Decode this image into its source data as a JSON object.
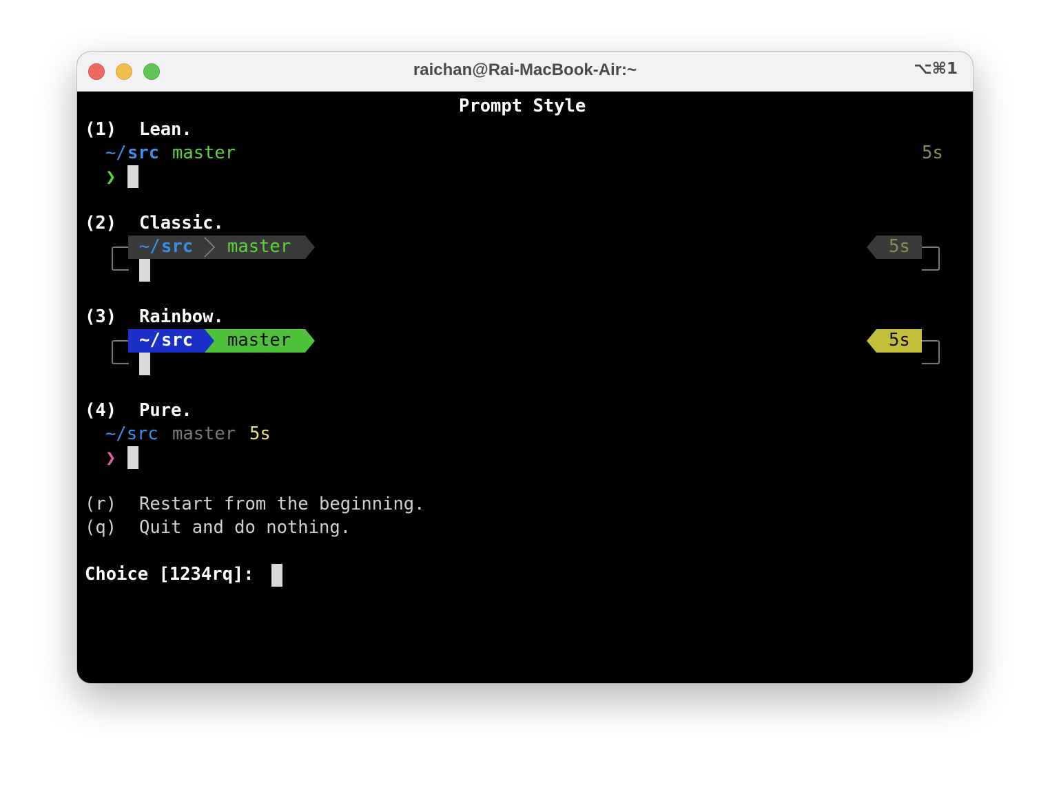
{
  "window": {
    "title": "raichan@Rai-MacBook-Air:~",
    "shortcut": "⌥⌘1"
  },
  "terminal": {
    "heading": "Prompt Style",
    "options": [
      {
        "key": "(1)",
        "label": "Lean.",
        "dir_prefix": "~/",
        "dir": "src",
        "branch": "master",
        "duration": "5s",
        "prompt_char": "❯"
      },
      {
        "key": "(2)",
        "label": "Classic.",
        "dir_prefix": "~/",
        "dir": "src",
        "branch": "master",
        "duration": "5s"
      },
      {
        "key": "(3)",
        "label": "Rainbow.",
        "dir_prefix": "~/",
        "dir": "src",
        "branch": "master",
        "duration": "5s"
      },
      {
        "key": "(4)",
        "label": "Pure.",
        "dir": "~/src",
        "branch": "master",
        "duration": "5s",
        "prompt_char": "❯"
      }
    ],
    "extra": [
      {
        "key": "(r)",
        "label": "Restart from the beginning."
      },
      {
        "key": "(q)",
        "label": "Quit and do nothing."
      }
    ],
    "choice_prompt": "Choice [1234rq]:"
  },
  "colors": {
    "lean_dir": "#3b8eea",
    "lean_branch": "#5fd33c",
    "lean_duration": "#8a8f5a",
    "classic_segment_bg": "#3a3a3a",
    "rainbow_dir_bg": "#1b2fc9",
    "rainbow_branch_bg": "#4ec23a",
    "rainbow_duration_bg": "#c4bf3b",
    "pure_prompt": "#e75fa7",
    "pure_duration": "#e6e07a"
  }
}
